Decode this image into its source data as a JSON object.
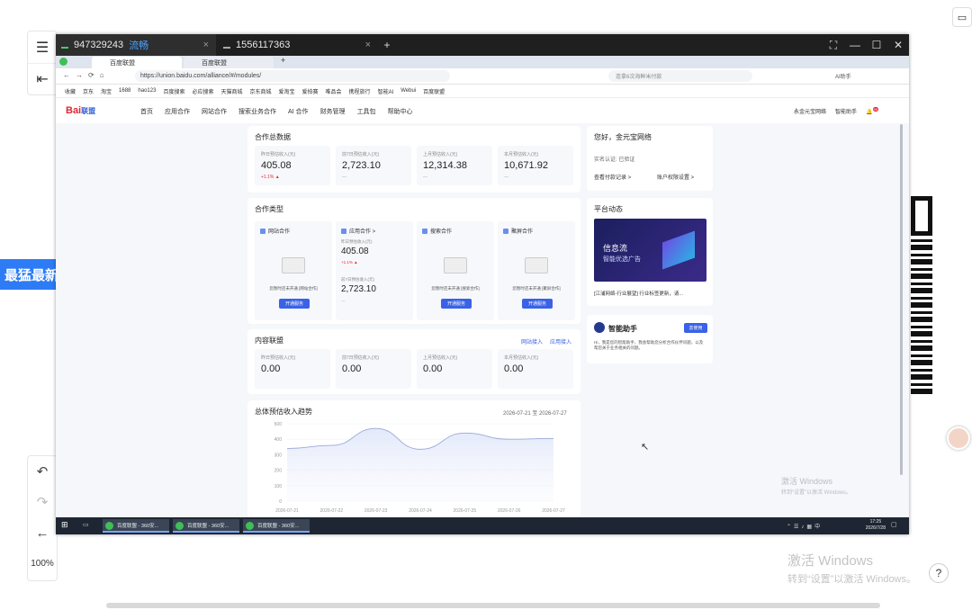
{
  "viewer": {
    "blue_tab": "最猛最新",
    "zoom": "100%",
    "watermark_title": "激活 Windows",
    "watermark_sub": "转到“设置”以激活 Windows。",
    "help": "?"
  },
  "remote": {
    "tabs": [
      {
        "number": "947329243",
        "tag": "流畅"
      },
      {
        "number": "1556117363",
        "tag": ""
      }
    ],
    "browser_tabs": [
      "百度联盟",
      "百度联盟"
    ],
    "url": "https://union.baidu.com/alliance/#/modules/",
    "search_placeholder": "连拿6次海鲜米付款",
    "bookmarks": [
      "收藏",
      "京东",
      "淘宝",
      "1688",
      "hao123",
      "百度搜索",
      "必应搜索",
      "天猫商城",
      "京东商城",
      "爱淘宝",
      "爱拍赛",
      "唯品会",
      "携程旅行",
      "智能AI",
      "Webui",
      "百度联盟"
    ],
    "ai_label": "AI助手",
    "watermark_title": "激活 Windows",
    "watermark_sub": "转到“设置”以激活 Windows。",
    "taskbar_items": [
      "百度联盟 - 360安...",
      "百度联盟 - 360安...",
      "百度联盟 - 360安..."
    ],
    "time": "17:25",
    "date": "2026/7/28"
  },
  "page": {
    "logo_bai": "Bai",
    "logo_union": "联盟",
    "nav": [
      "首页",
      "应用合作",
      "网站合作",
      "搜索业务合作",
      "AI 合作",
      "财务管理",
      "工具包",
      "帮助中心"
    ],
    "nav_right": [
      "永金元宝网络",
      "智能助手"
    ],
    "badge": "99",
    "total": {
      "title": "合作总数据",
      "stats": [
        {
          "label": "昨日预估收入(元)",
          "value": "405.08",
          "sub": "+1.1% ▲"
        },
        {
          "label": "前7日预估收入(元)",
          "value": "2,723.10",
          "sub": "—"
        },
        {
          "label": "上月预估收入(元)",
          "value": "12,314.38",
          "sub": "—"
        },
        {
          "label": "本月预估收入(元)",
          "value": "10,671.92",
          "sub": "—"
        }
      ]
    },
    "coop": {
      "title": "合作类型",
      "items": [
        {
          "title": "网站合作",
          "tip": "您暂时还未开通 [网站合作]",
          "button": "开通服务"
        },
        {
          "title": "应用合作 >",
          "l1": "昨日预估收入(元)",
          "v1": "405.08",
          "s1": "+1.1% ▲",
          "l2": "前7日预估收入(元)",
          "v2": "2,723.10",
          "d2": "—"
        },
        {
          "title": "搜索合作",
          "tip": "您暂时还未开通 [搜索合作]",
          "button": "开通服务"
        },
        {
          "title": "聚屏合作",
          "tip": "您暂时还未开通 [聚屏合作]",
          "button": "开通服务"
        }
      ]
    },
    "content": {
      "title": "内容联盟",
      "links": [
        "网站接入",
        "应用接入"
      ],
      "stats": [
        {
          "label": "昨日预估收入(元)",
          "value": "0.00"
        },
        {
          "label": "前7日预估收入(元)",
          "value": "0.00"
        },
        {
          "label": "上月预估收入(元)",
          "value": "0.00"
        },
        {
          "label": "本月预估收入(元)",
          "value": "0.00"
        }
      ]
    },
    "right": {
      "greeting": "您好，金元宝网络",
      "verify": "实名认证: 已验证",
      "link1": "查看付款记录 >",
      "link2": "账户权限设置 >",
      "platform_title": "平台动态",
      "banner_line1": "信息流",
      "banner_line2": "智能优选广告",
      "news": "[江浦网络-行业展望] 行业标签更新，请...",
      "assistant_title": "智能助手",
      "assistant_btn": "去使用",
      "assistant_desc": "Hi，我是您的智能助手，我会帮助您分析合作伙伴问题，以及帮您关于业务相关的问题。"
    }
  },
  "chart_data": {
    "type": "area",
    "title": "总体预估收入趋势",
    "date_range": "2026-07-21 至 2026-07-27",
    "x": [
      "2026-07-21",
      "2026-07-22",
      "2026-07-23",
      "2026-07-24",
      "2026-07-25",
      "2026-07-26",
      "2026-07-27"
    ],
    "y": [
      340,
      360,
      470,
      335,
      440,
      400,
      405
    ],
    "yticks": [
      0,
      100,
      200,
      300,
      400,
      500
    ],
    "ylim": [
      0,
      500
    ],
    "color": "#9aa9d8"
  }
}
